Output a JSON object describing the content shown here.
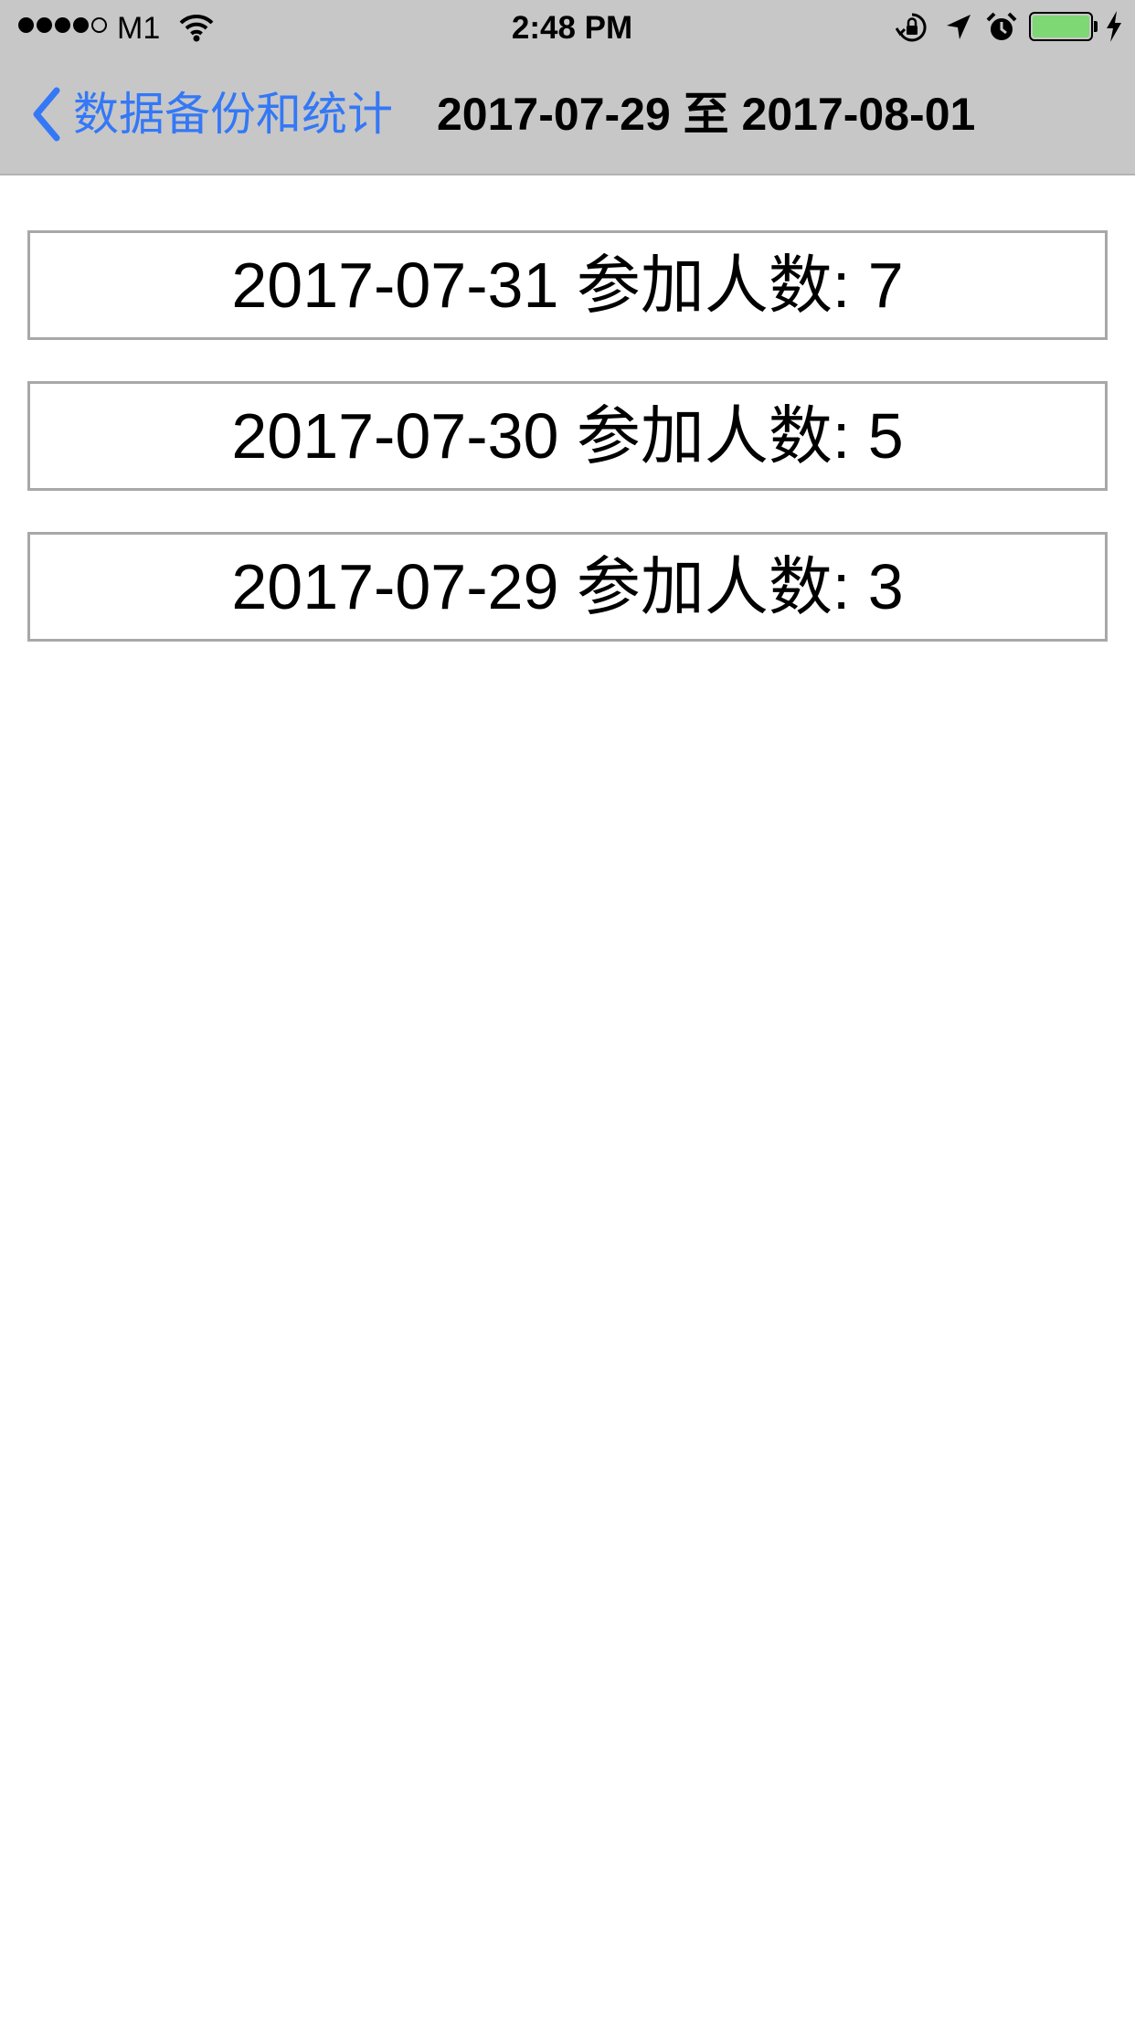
{
  "status_bar": {
    "carrier": "M1",
    "time": "2:48 PM",
    "signal_bars_filled": 4,
    "signal_bars_total": 5,
    "icons": [
      "wifi-icon",
      "orientation-lock-icon",
      "location-arrow-icon",
      "alarm-icon",
      "battery-icon",
      "charging-bolt-icon"
    ],
    "battery_color": "#7ed874"
  },
  "nav": {
    "back_label": "数据备份和统计",
    "title": "2017-07-29 至 2017-08-01",
    "accent_color": "#3478f6",
    "back_icon": "chevron-left-icon"
  },
  "records": [
    {
      "label": "2017-07-31 参加人数: 7"
    },
    {
      "label": "2017-07-30 参加人数: 5"
    },
    {
      "label": "2017-07-29 参加人数: 3"
    }
  ]
}
